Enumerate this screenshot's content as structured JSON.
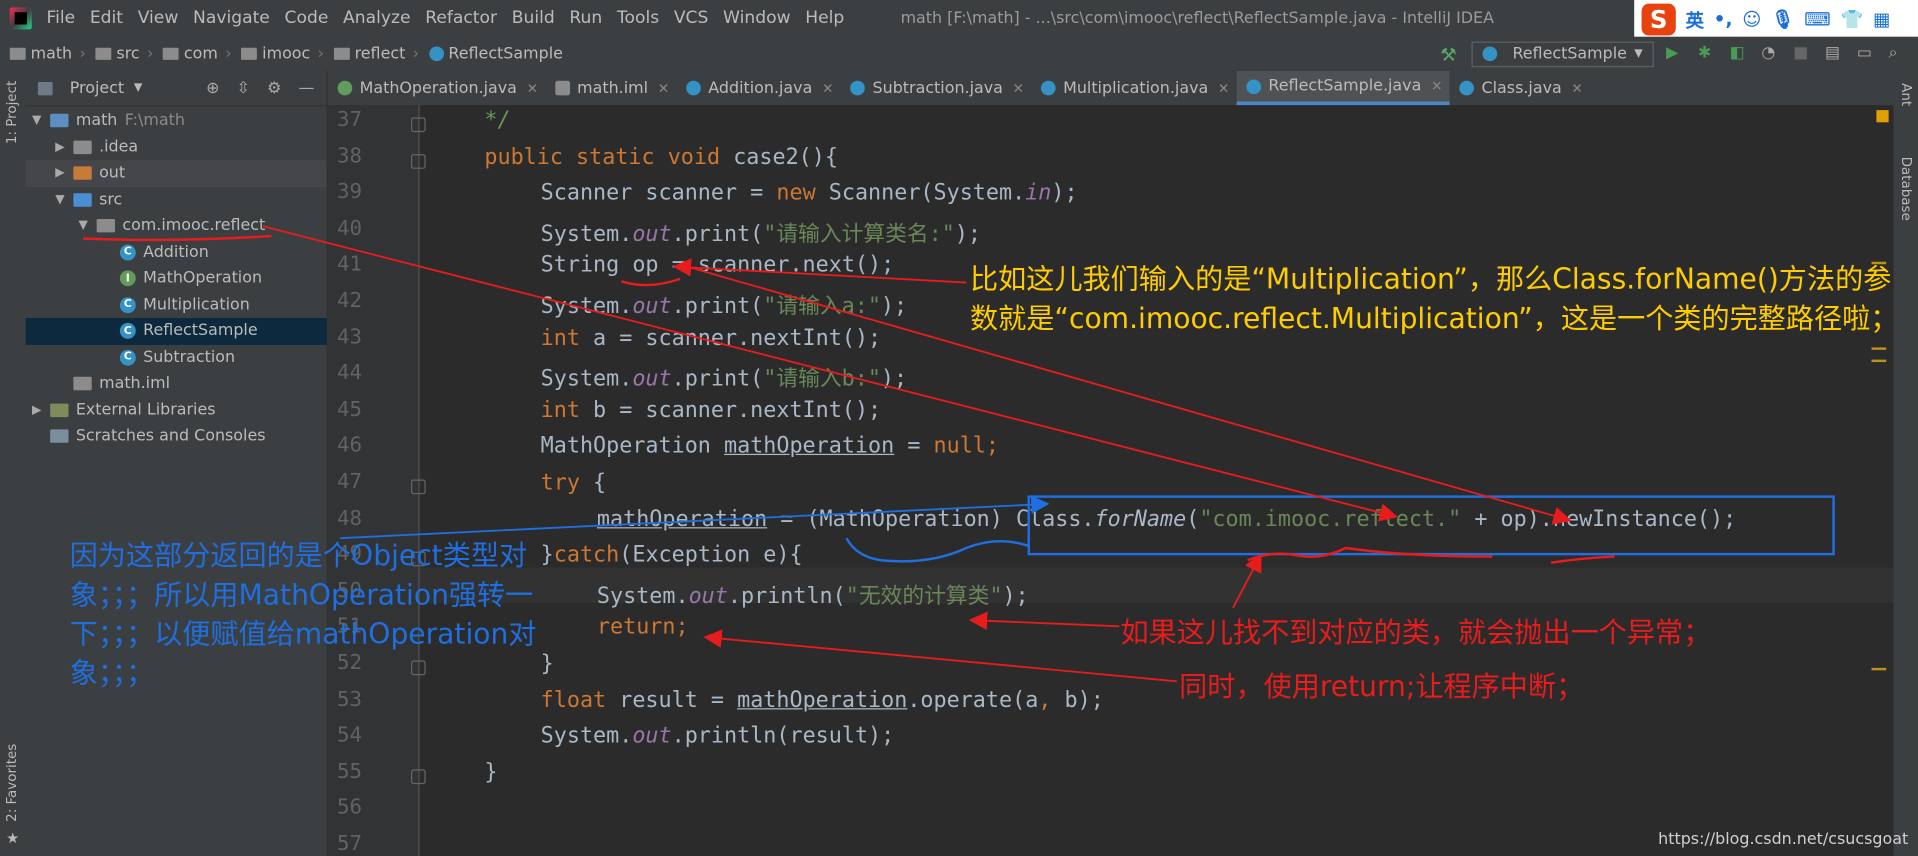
{
  "titlebar": {
    "menu": [
      "File",
      "Edit",
      "View",
      "Navigate",
      "Code",
      "Analyze",
      "Refactor",
      "Build",
      "Run",
      "Tools",
      "VCS",
      "Window",
      "Help"
    ],
    "window_title": "math [F:\\math] - ...\\src\\com\\imooc\\reflect\\ReflectSample.java - IntelliJ IDEA"
  },
  "ime": {
    "logo": "S",
    "lang": "英"
  },
  "breadcrumb": [
    "math",
    "src",
    "com",
    "imooc",
    "reflect",
    "ReflectSample"
  ],
  "run_config": "ReflectSample",
  "project_panel": {
    "title": "Project",
    "tree": [
      {
        "label": "math",
        "sub": "F:\\math",
        "indent": 0,
        "arrow": "▼",
        "icon": "module"
      },
      {
        "label": ".idea",
        "indent": 1,
        "arrow": "▶",
        "icon": "folder"
      },
      {
        "label": "out",
        "indent": 1,
        "arrow": "▶",
        "icon": "folder-orange"
      },
      {
        "label": "src",
        "indent": 1,
        "arrow": "▼",
        "icon": "folder-blue"
      },
      {
        "label": "com.imooc.reflect",
        "indent": 2,
        "arrow": "▼",
        "icon": "package"
      },
      {
        "label": "Addition",
        "indent": 3,
        "arrow": "",
        "icon": "class"
      },
      {
        "label": "MathOperation",
        "indent": 3,
        "arrow": "",
        "icon": "interface"
      },
      {
        "label": "Multiplication",
        "indent": 3,
        "arrow": "",
        "icon": "class"
      },
      {
        "label": "ReflectSample",
        "indent": 3,
        "arrow": "",
        "icon": "class",
        "selected": true
      },
      {
        "label": "Subtraction",
        "indent": 3,
        "arrow": "",
        "icon": "class"
      },
      {
        "label": "math.iml",
        "indent": 1,
        "arrow": "",
        "icon": "iml"
      },
      {
        "label": "External Libraries",
        "indent": 0,
        "arrow": "▶",
        "icon": "libs"
      },
      {
        "label": "Scratches and Consoles",
        "indent": 0,
        "arrow": "",
        "icon": "scratch"
      }
    ]
  },
  "left_stripe": {
    "project_tab": "1: Project",
    "favorites_tab": "2: Favorites"
  },
  "right_stripe": {
    "ant_tab": "Ant",
    "database_tab": "Database"
  },
  "tabs": [
    {
      "label": "MathOperation.java",
      "icon": "interface"
    },
    {
      "label": "math.iml",
      "icon": "iml"
    },
    {
      "label": "Addition.java",
      "icon": "class"
    },
    {
      "label": "Subtraction.java",
      "icon": "class"
    },
    {
      "label": "Multiplication.java",
      "icon": "class"
    },
    {
      "label": "ReflectSample.java",
      "icon": "class",
      "active": true
    },
    {
      "label": "Class.java",
      "icon": "class-lib"
    }
  ],
  "code_lines": [
    {
      "n": "37",
      "indent": 1,
      "parts": [
        [
          "cm",
          "*/"
        ]
      ]
    },
    {
      "n": "38",
      "indent": 1,
      "parts": [
        [
          "kw",
          "public static void "
        ],
        [
          "",
          "case2(){"
        ]
      ]
    },
    {
      "n": "39",
      "indent": 2,
      "parts": [
        [
          "",
          "Scanner scanner = "
        ],
        [
          "kw",
          "new "
        ],
        [
          "",
          "Scanner(System."
        ],
        [
          "it",
          "in"
        ],
        [
          "",
          ");"
        ]
      ]
    },
    {
      "n": "40",
      "indent": 2,
      "parts": [
        [
          "",
          "System."
        ],
        [
          "it",
          "out"
        ],
        [
          "",
          ".print("
        ],
        [
          "str",
          "\"请输入计算类名:\""
        ],
        [
          "",
          ");"
        ]
      ]
    },
    {
      "n": "41",
      "indent": 2,
      "parts": [
        [
          "",
          "String op = scanner.next();"
        ]
      ]
    },
    {
      "n": "42",
      "indent": 2,
      "parts": [
        [
          "",
          "System."
        ],
        [
          "it",
          "out"
        ],
        [
          "",
          ".print("
        ],
        [
          "str",
          "\"请输入a:\""
        ],
        [
          "",
          ");"
        ]
      ]
    },
    {
      "n": "43",
      "indent": 2,
      "parts": [
        [
          "kw",
          "int "
        ],
        [
          "",
          "a = scanner.nextInt();"
        ]
      ]
    },
    {
      "n": "44",
      "indent": 2,
      "parts": [
        [
          "",
          "System."
        ],
        [
          "it",
          "out"
        ],
        [
          "",
          ".print("
        ],
        [
          "str",
          "\"请输入b:\""
        ],
        [
          "",
          ");"
        ]
      ]
    },
    {
      "n": "45",
      "indent": 2,
      "parts": [
        [
          "kw",
          "int "
        ],
        [
          "",
          "b = scanner.nextInt();"
        ]
      ]
    },
    {
      "n": "46",
      "indent": 2,
      "parts": [
        [
          "",
          "MathOperation "
        ],
        [
          "ul",
          "mathOperation"
        ],
        [
          "",
          " = "
        ],
        [
          "kw",
          "null"
        ],
        [
          "kw",
          ";"
        ]
      ]
    },
    {
      "n": "47",
      "indent": 2,
      "parts": [
        [
          "kw",
          "try "
        ],
        [
          "",
          "{"
        ]
      ]
    },
    {
      "n": "48",
      "indent": 3,
      "parts": [
        [
          "ul",
          "mathOperation"
        ],
        [
          "",
          " = (MathOperation) Class."
        ],
        [
          "method",
          "forName"
        ],
        [
          "",
          "("
        ],
        [
          "str",
          "\"com.imooc.reflect.\""
        ],
        [
          "",
          " + op).newInstance();"
        ]
      ]
    },
    {
      "n": "49",
      "indent": 2,
      "parts": [
        [
          "",
          "}"
        ],
        [
          "kw",
          "catch"
        ],
        [
          "",
          "(Exception e){"
        ]
      ]
    },
    {
      "n": "50",
      "indent": 3,
      "parts": [
        [
          "",
          "System."
        ],
        [
          "it",
          "out"
        ],
        [
          "",
          ".println("
        ],
        [
          "str",
          "\"无效的计算类\""
        ],
        [
          "",
          ");"
        ]
      ]
    },
    {
      "n": "51",
      "indent": 3,
      "parts": [
        [
          "kw",
          "return;"
        ]
      ]
    },
    {
      "n": "52",
      "indent": 2,
      "parts": [
        [
          "",
          "}"
        ]
      ]
    },
    {
      "n": "53",
      "indent": 2,
      "parts": [
        [
          "kw",
          "float "
        ],
        [
          "",
          "result = "
        ],
        [
          "ul",
          "mathOperation"
        ],
        [
          "",
          ".operate(a"
        ],
        [
          "kw",
          ", "
        ],
        [
          "",
          "b);"
        ]
      ]
    },
    {
      "n": "54",
      "indent": 2,
      "parts": [
        [
          "",
          "System."
        ],
        [
          "it",
          "out"
        ],
        [
          "",
          ".println(result);"
        ]
      ]
    },
    {
      "n": "55",
      "indent": 1,
      "parts": [
        [
          "",
          "}"
        ]
      ]
    },
    {
      "n": "56",
      "indent": 0,
      "parts": []
    },
    {
      "n": "57",
      "indent": 0,
      "parts": []
    }
  ],
  "annotations": {
    "note_forname": "比如这儿我们输入的是“Multiplication”，那么Class.forName()方法的参数就是“com.imooc.reflect.Multiplication”，这是一个类的完整路径啦；",
    "note_cast": "因为这部分返回的是个Object类型对象；；；所以用MathOperation强转一下；；；以便赋值给mathOperation对象；；；",
    "note_exception": "如果这儿找不到对应的类，就会抛出一个异常；",
    "note_return": "同时，使用return;让程序中断；"
  },
  "watermark": "https://blog.csdn.net/csucsgoat",
  "colors": {
    "keyword": "#cc7832",
    "string": "#6a8759",
    "field": "#9876aa",
    "annotation_yellow": "#ffcc00",
    "annotation_blue": "#1f6fe0",
    "annotation_red": "#e81c1c"
  }
}
